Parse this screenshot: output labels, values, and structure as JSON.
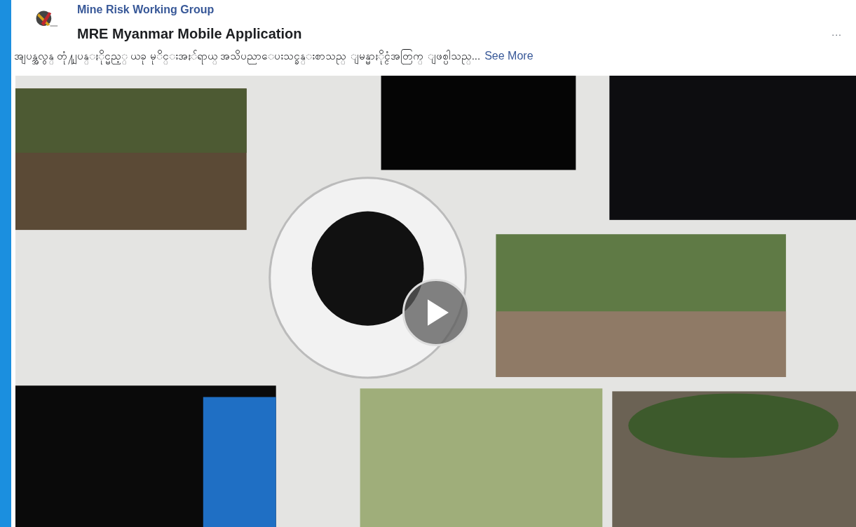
{
  "post": {
    "author": "Mine Risk Working Group",
    "title": "MRE Myanmar Mobile Application",
    "menu": "...",
    "description": "အျပန္အလွန္ တုံ႔ျပန္ႏိုင္မည့္ ယခု မုိင္းအႏၲရာယ္ အသိပညာေပးသင္ခန္းစာသည္ ျမန္မာႏိုင္ငံအတြက္ ျဖစ္ပါသည္...",
    "see_more": "See More"
  }
}
